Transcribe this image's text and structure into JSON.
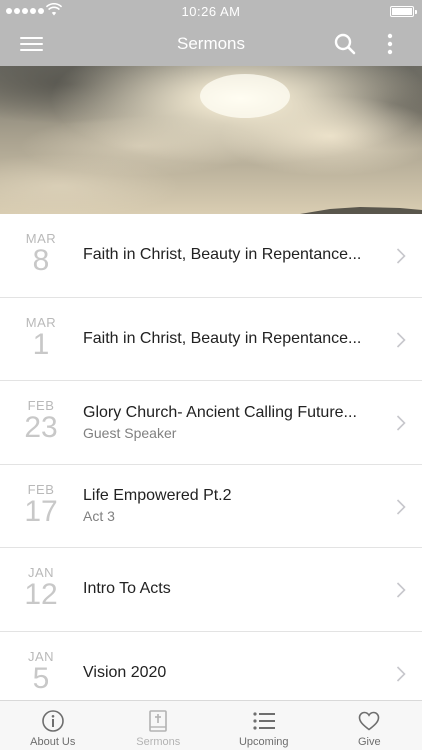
{
  "status_bar": {
    "time": "10:26 AM"
  },
  "header": {
    "title": "Sermons",
    "menu_icon": "hamburger-menu-icon",
    "search_icon": "search-icon",
    "more_icon": "more-vertical-icon"
  },
  "hero": {
    "image": "sky-clouds-sunlight"
  },
  "sermons": [
    {
      "month": "MAR",
      "day": "8",
      "title": "Faith in Christ, Beauty in Repentance...",
      "subtitle": ""
    },
    {
      "month": "MAR",
      "day": "1",
      "title": "Faith in Christ, Beauty in Repentance...",
      "subtitle": ""
    },
    {
      "month": "FEB",
      "day": "23",
      "title": "Glory Church- Ancient Calling Future...",
      "subtitle": "Guest Speaker"
    },
    {
      "month": "FEB",
      "day": "17",
      "title": "Life Empowered Pt.2",
      "subtitle": "Act 3"
    },
    {
      "month": "JAN",
      "day": "12",
      "title": "Intro To Acts",
      "subtitle": ""
    },
    {
      "month": "JAN",
      "day": "5",
      "title": "Vision 2020",
      "subtitle": ""
    }
  ],
  "tabs": [
    {
      "label": "About Us",
      "icon": "info-icon",
      "active": false
    },
    {
      "label": "Sermons",
      "icon": "bible-icon",
      "active": true
    },
    {
      "label": "Upcoming",
      "icon": "list-icon",
      "active": false
    },
    {
      "label": "Give",
      "icon": "heart-icon",
      "active": false
    }
  ],
  "colors": {
    "bar": "#b9b9b9",
    "date_gray": "#b9b9b9",
    "tab_bg": "#f7f7f7"
  }
}
